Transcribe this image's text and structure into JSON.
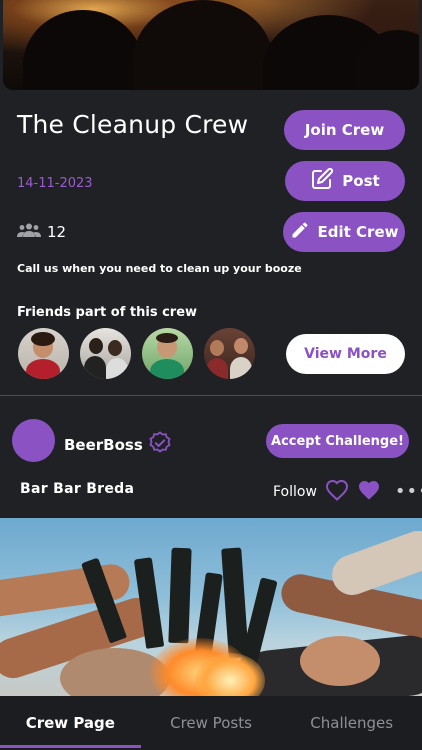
{
  "crew": {
    "name": "The Cleanup Crew",
    "date": "14-11-2023",
    "member_count": "12",
    "description": "Call us when you need to clean up your booze",
    "friends_label": "Friends part of this crew"
  },
  "actions": {
    "join": "Join Crew",
    "post": "Post",
    "edit": "Edit Crew",
    "view_more": "View More"
  },
  "feed_post": {
    "username": "BeerBoss",
    "accept_label": "Accept Challenge!",
    "place": "Bar Bar  Breda",
    "follow_label": "Follow",
    "more": "•••"
  },
  "tabs": [
    {
      "label": "Crew Page",
      "active": true
    },
    {
      "label": "Crew Posts",
      "active": false
    },
    {
      "label": "Challenges",
      "active": false
    }
  ],
  "colors": {
    "accent": "#8b52c4",
    "background": "#1f2125",
    "date": "#9a5cd0"
  },
  "icons": {
    "members": "group-icon",
    "post": "edit-square-icon",
    "edit": "pencil-icon",
    "verified": "verified-badge-icon",
    "like_outline": "heart-outline-icon",
    "like_filled": "heart-filled-icon"
  }
}
